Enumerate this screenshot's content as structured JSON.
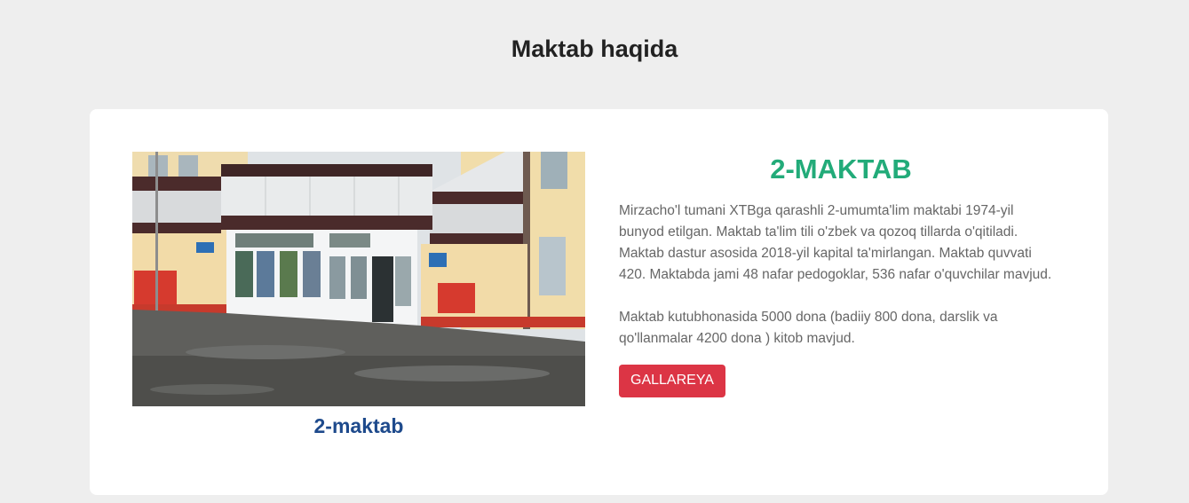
{
  "section": {
    "heading": "Maktab haqida"
  },
  "school": {
    "photo_caption": "2-maktab",
    "title": "2-MAKTAB",
    "description_1": "Mirzacho'l tumani XTBga qarashli 2-umumta'lim maktabi 1974-yil bunyod etilgan. Maktab ta'lim tili o'zbek va qozoq tillarda o'qitiladi. Maktab dastur asosida 2018-yil kapital ta'mirlangan. Maktab quvvati 420. Maktabda jami 48 nafar pedogoklar, 536 nafar o'quvchilar mavjud.",
    "description_2": "Maktab kutubhonasida 5000 dona (badiiy 800 dona, darslik va qo'llanmalar 4200 dona ) kitob mavjud.",
    "gallery_button": "GALLAREYA"
  },
  "colors": {
    "background": "#eeeeee",
    "card": "#ffffff",
    "title_green": "#22ab79",
    "caption_blue": "#1e4a8c",
    "button_red": "#dc3545"
  }
}
